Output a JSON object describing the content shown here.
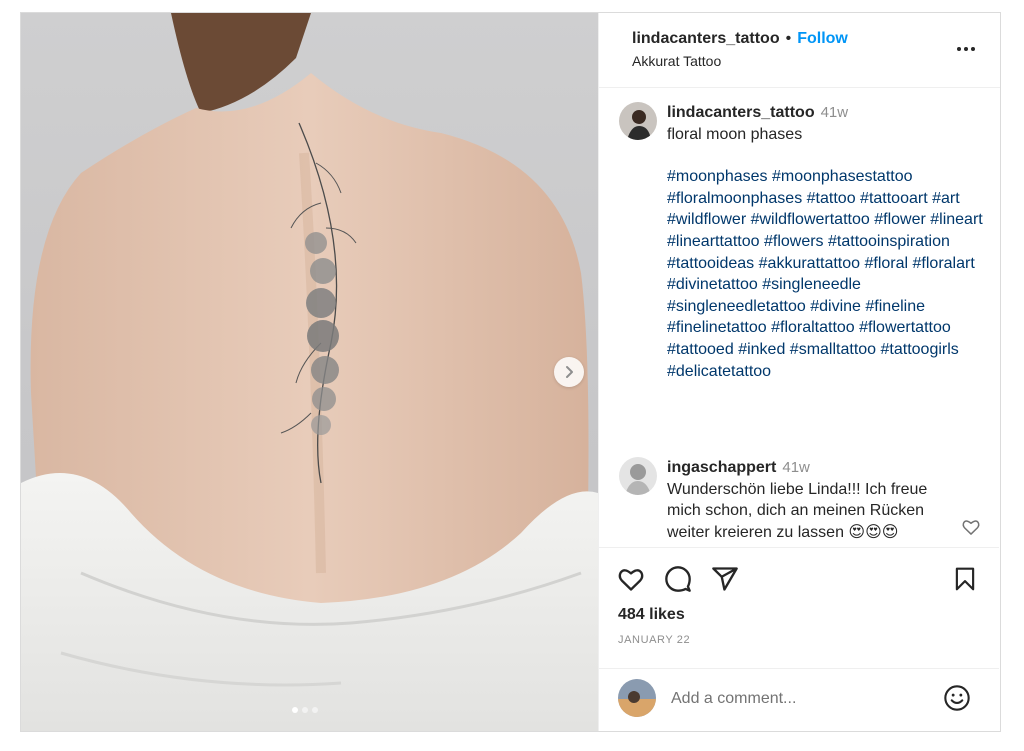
{
  "header": {
    "username": "lindacanters_tattoo",
    "separator": "•",
    "follow_label": "Follow",
    "location": "Akkurat Tattoo"
  },
  "caption": {
    "username": "lindacanters_tattoo",
    "time": "41w",
    "text": "floral moon phases",
    "hashtags": [
      "#moonphases",
      "#moonphasestattoo",
      "#floralmoonphases",
      "#tattoo",
      "#tattooart",
      "#art",
      "#wildflower",
      "#wildflowertattoo",
      "#flower",
      "#lineart",
      "#linearttattoo",
      "#flowers",
      "#tattooinspiration",
      "#tattooideas",
      "#akkurattattoo",
      "#floral",
      "#floralart",
      "#divinetattoo",
      "#singleneedle",
      "#singleneedletattoo",
      "#divine",
      "#fineline",
      "#finelinetattoo",
      "#floraltattoo",
      "#flowertattoo",
      "#tattooed",
      "#inked",
      "#smalltattoo",
      "#tattoogirls",
      "#delicatetattoo"
    ]
  },
  "comment": {
    "username": "ingaschappert",
    "time": "41w",
    "text": "Wunderschön liebe Linda!!! Ich freue mich schon, dich an meinen Rücken weiter kreieren zu lassen 😍😍😍"
  },
  "actions": {
    "likes": "484 likes",
    "date": "JANUARY 22",
    "icons": [
      "heart-icon",
      "comment-icon",
      "share-icon",
      "bookmark-icon"
    ]
  },
  "composer": {
    "placeholder": "Add a comment..."
  },
  "carousel": {
    "current": 1,
    "total": 3
  },
  "colors": {
    "follow": "#0095f6",
    "hashtag": "#00376b",
    "muted": "#8e8e8e",
    "text": "#262626"
  }
}
